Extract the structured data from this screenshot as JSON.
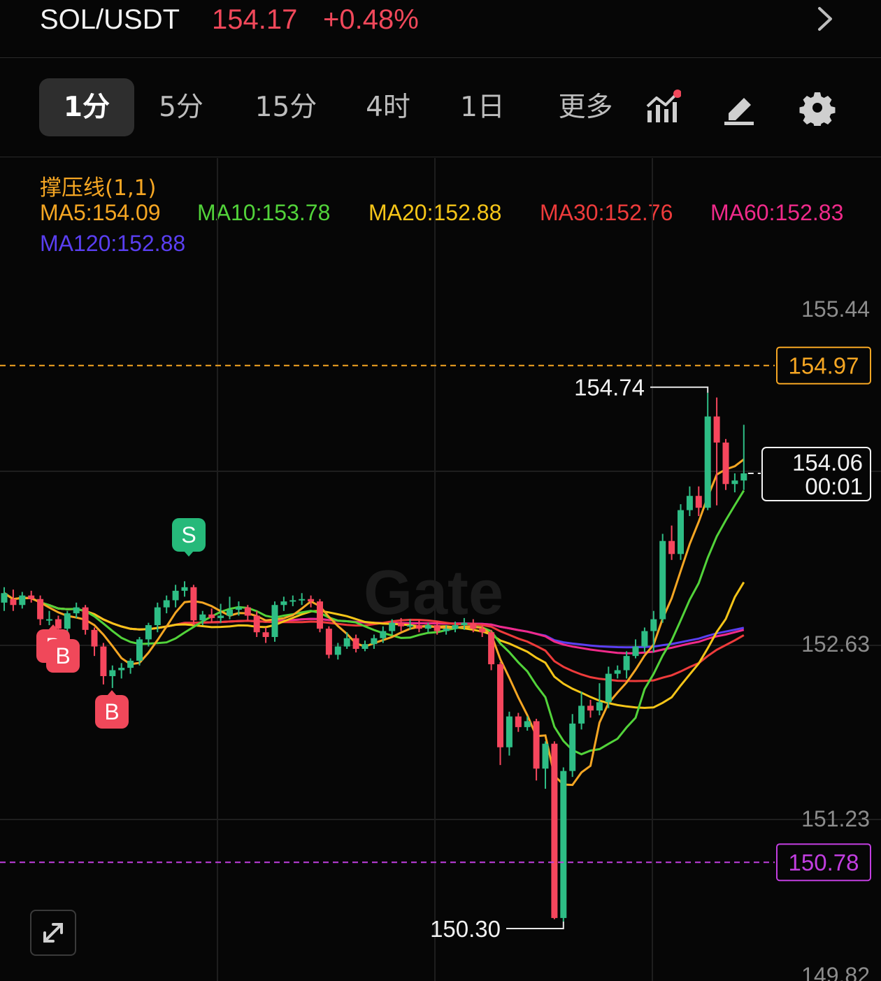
{
  "header": {
    "pair": "SOL/USDT",
    "price": "154.17",
    "change": "+0.48%",
    "price_color": "#f0485a"
  },
  "tabs": [
    {
      "label": "1分",
      "active": true
    },
    {
      "label": "5分",
      "active": false
    },
    {
      "label": "15分",
      "active": false
    },
    {
      "label": "4时",
      "active": false
    },
    {
      "label": "1日",
      "active": false
    },
    {
      "label": "更多",
      "active": false
    }
  ],
  "tools": {
    "indicator_icon": "indicator-chart-icon",
    "draw_icon": "pencil-icon",
    "settings_icon": "gear-icon",
    "notification_dot_color": "#f0485a"
  },
  "indicator": {
    "label": "撑压线(1,1)",
    "ma": [
      {
        "text": "MA5:154.09",
        "color": "#f5a623"
      },
      {
        "text": "MA10:153.78",
        "color": "#52d33a"
      },
      {
        "text": "MA20:152.88",
        "color": "#f5c518"
      },
      {
        "text": "MA30:152.76",
        "color": "#ee3b3b"
      },
      {
        "text": "MA60:152.83",
        "color": "#f02a8a"
      },
      {
        "text": "MA120:152.88",
        "color": "#5a3ff2"
      }
    ]
  },
  "chart_data": {
    "type": "candlestick",
    "y_ticks": [
      "155.44",
      "152.63",
      "151.23",
      "149.82"
    ],
    "ylim": [
      149.82,
      155.44
    ],
    "resistance": {
      "value": "154.97",
      "color": "#f5a623"
    },
    "support": {
      "value": "150.78",
      "color": "#c23ee0"
    },
    "high_label": "154.74",
    "low_label": "150.30",
    "current": {
      "price": "154.06",
      "countdown": "00:01"
    },
    "markers": [
      {
        "type": "S",
        "color": "#26b97a"
      },
      {
        "type": "B",
        "color": "#f0485a"
      },
      {
        "type": "B",
        "color": "#f0485a"
      },
      {
        "type": "B",
        "color": "#f0485a"
      }
    ],
    "up_color": "#2ebd85",
    "down_color": "#f6465d",
    "candles": [
      [
        152.97,
        153.05,
        153.1,
        152.9
      ],
      [
        153.0,
        152.95,
        153.08,
        152.9
      ],
      [
        152.95,
        153.03,
        153.06,
        152.92
      ],
      [
        153.03,
        153.0,
        153.07,
        152.97
      ],
      [
        153.0,
        152.83,
        153.03,
        152.78
      ],
      [
        152.83,
        152.83,
        152.9,
        152.78
      ],
      [
        152.83,
        152.75,
        152.86,
        152.7
      ],
      [
        152.75,
        152.88,
        152.9,
        152.72
      ],
      [
        152.88,
        152.93,
        152.97,
        152.84
      ],
      [
        152.93,
        152.74,
        152.95,
        152.7
      ],
      [
        152.74,
        152.6,
        152.76,
        152.52
      ],
      [
        152.6,
        152.35,
        152.63,
        152.28
      ],
      [
        152.35,
        152.4,
        152.44,
        152.25
      ],
      [
        152.4,
        152.42,
        152.46,
        152.33
      ],
      [
        152.42,
        152.48,
        152.5,
        152.37
      ],
      [
        152.48,
        152.66,
        152.68,
        152.44
      ],
      [
        152.66,
        152.78,
        152.8,
        152.6
      ],
      [
        152.78,
        152.93,
        152.97,
        152.72
      ],
      [
        152.93,
        152.99,
        153.03,
        152.88
      ],
      [
        152.99,
        153.07,
        153.12,
        152.93
      ],
      [
        153.07,
        153.1,
        153.15,
        153.02
      ],
      [
        153.1,
        152.82,
        153.12,
        152.78
      ],
      [
        152.82,
        152.87,
        152.9,
        152.78
      ],
      [
        152.87,
        152.84,
        152.92,
        152.8
      ],
      [
        152.84,
        152.86,
        152.96,
        152.8
      ],
      [
        152.86,
        152.91,
        153.02,
        152.83
      ],
      [
        152.91,
        152.93,
        152.98,
        152.86
      ],
      [
        152.93,
        152.86,
        152.95,
        152.82
      ],
      [
        152.86,
        152.72,
        152.9,
        152.68
      ],
      [
        152.72,
        152.68,
        152.76,
        152.63
      ],
      [
        152.68,
        152.95,
        152.98,
        152.64
      ],
      [
        152.95,
        152.98,
        153.02,
        152.9
      ],
      [
        152.98,
        152.99,
        153.03,
        152.94
      ],
      [
        152.99,
        153.0,
        153.05,
        152.95
      ],
      [
        153.0,
        152.98,
        153.03,
        152.93
      ],
      [
        152.98,
        152.75,
        153.0,
        152.72
      ],
      [
        152.75,
        152.53,
        152.77,
        152.5
      ],
      [
        152.53,
        152.6,
        152.63,
        152.49
      ],
      [
        152.6,
        152.67,
        152.72,
        152.58
      ],
      [
        152.67,
        152.58,
        152.7,
        152.55
      ],
      [
        152.58,
        152.62,
        152.65,
        152.56
      ],
      [
        152.62,
        152.67,
        152.7,
        152.58
      ],
      [
        152.67,
        152.73,
        152.77,
        152.63
      ],
      [
        152.73,
        152.8,
        152.83,
        152.7
      ],
      [
        152.8,
        152.77,
        152.84,
        152.73
      ],
      [
        152.77,
        152.78,
        152.83,
        152.74
      ],
      [
        152.78,
        152.75,
        152.82,
        152.72
      ],
      [
        152.75,
        152.78,
        152.8,
        152.72
      ],
      [
        152.78,
        152.73,
        152.81,
        152.7
      ],
      [
        152.73,
        152.75,
        152.78,
        152.7
      ],
      [
        152.75,
        152.78,
        152.81,
        152.72
      ],
      [
        152.78,
        152.8,
        152.84,
        152.74
      ],
      [
        152.8,
        152.75,
        152.83,
        152.72
      ],
      [
        152.75,
        152.72,
        152.78,
        152.68
      ],
      [
        152.72,
        152.45,
        152.74,
        152.4
      ],
      [
        152.45,
        151.75,
        152.47,
        151.6
      ],
      [
        151.75,
        152.01,
        152.05,
        151.68
      ],
      [
        152.01,
        151.92,
        152.04,
        151.88
      ],
      [
        151.92,
        151.97,
        152.01,
        151.89
      ],
      [
        151.97,
        151.57,
        151.99,
        151.47
      ],
      [
        151.57,
        151.78,
        151.8,
        151.4
      ],
      [
        151.78,
        150.31,
        151.8,
        150.3
      ],
      [
        150.31,
        151.55,
        151.58,
        150.28
      ],
      [
        151.55,
        151.95,
        152.03,
        151.5
      ],
      [
        151.95,
        152.1,
        152.22,
        151.9
      ],
      [
        152.1,
        152.06,
        152.15,
        152.0
      ],
      [
        152.06,
        152.13,
        152.29,
        152.02
      ],
      [
        152.13,
        152.37,
        152.43,
        152.08
      ],
      [
        152.37,
        152.4,
        152.44,
        152.33
      ],
      [
        152.4,
        152.52,
        152.56,
        152.33
      ],
      [
        152.52,
        152.6,
        152.66,
        152.5
      ],
      [
        152.6,
        152.73,
        152.76,
        152.55
      ],
      [
        152.73,
        152.83,
        152.9,
        152.55
      ],
      [
        152.83,
        153.49,
        153.55,
        152.8
      ],
      [
        153.49,
        153.38,
        153.62,
        153.33
      ],
      [
        153.38,
        153.75,
        153.8,
        153.33
      ],
      [
        153.75,
        153.87,
        153.95,
        153.7
      ],
      [
        153.87,
        153.77,
        153.95,
        153.7
      ],
      [
        153.77,
        154.54,
        154.74,
        153.75
      ],
      [
        154.54,
        154.32,
        154.7,
        153.79
      ],
      [
        154.32,
        153.97,
        154.35,
        153.92
      ],
      [
        153.97,
        154.0,
        154.06,
        153.9
      ],
      [
        154.0,
        154.06,
        154.47,
        153.92
      ]
    ]
  },
  "watermark": "Gate"
}
